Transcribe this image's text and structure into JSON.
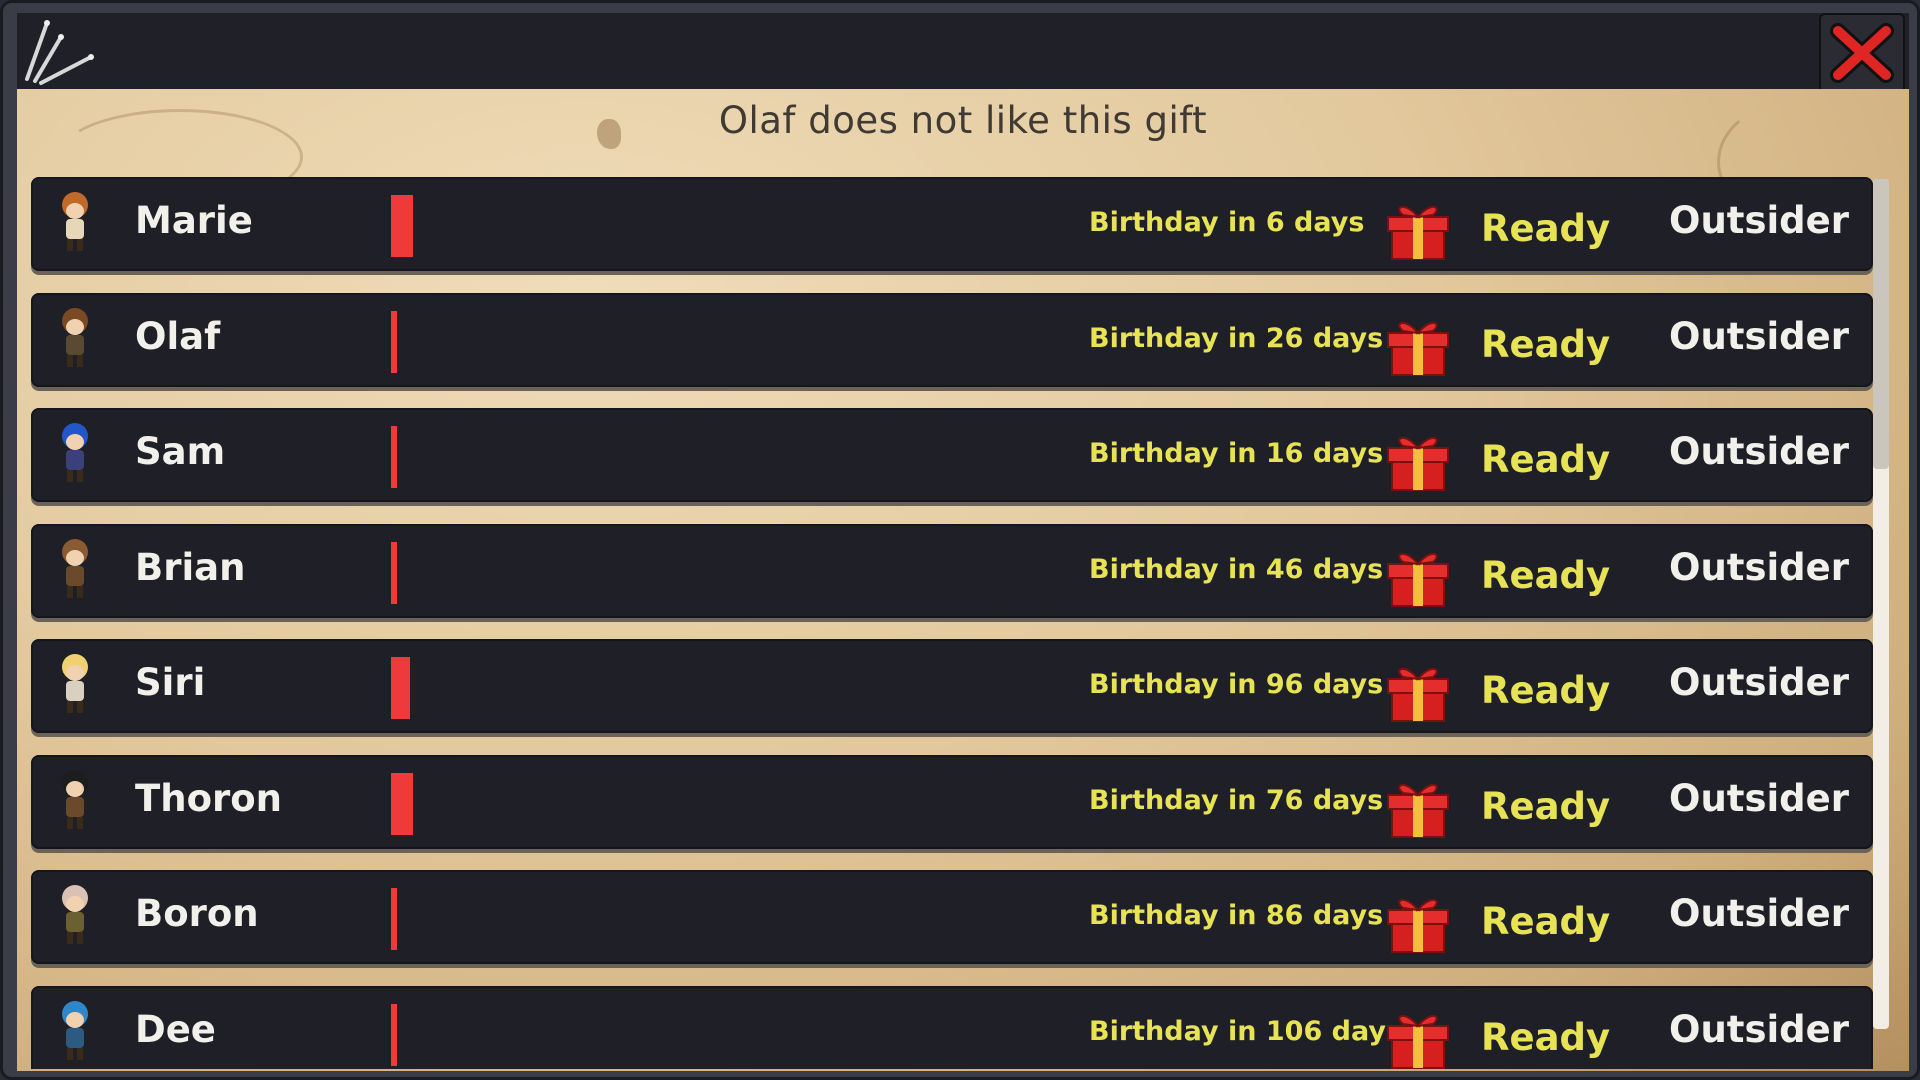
{
  "heading": "Olaf does not like this gift",
  "close_icon": "close-x-icon",
  "quill_icon": "quill-icon",
  "gift_icon": "gift-box-icon",
  "colors": {
    "bar": "#ee3a3a",
    "yellow_text": "#e8e355",
    "close": "#e02525"
  },
  "rows": [
    {
      "name": "Marie",
      "affection": 0.9,
      "birthday": "Birthday in 6 days",
      "gift_status": "Ready",
      "relation": "Outsider",
      "hair": "#c06a2a",
      "body": "#e6d7b8"
    },
    {
      "name": "Olaf",
      "affection": 0.2,
      "birthday": "Birthday in 26 days",
      "gift_status": "Ready",
      "relation": "Outsider",
      "hair": "#7a4a22",
      "body": "#5b4a32"
    },
    {
      "name": "Sam",
      "affection": 0.2,
      "birthday": "Birthday in 16 days",
      "gift_status": "Ready",
      "relation": "Outsider",
      "hair": "#2356c9",
      "body": "#3b3f7a"
    },
    {
      "name": "Brian",
      "affection": 0.2,
      "birthday": "Birthday in 46 days",
      "gift_status": "Ready",
      "relation": "Outsider",
      "hair": "#8a5a32",
      "body": "#6a4a2a"
    },
    {
      "name": "Siri",
      "affection": 0.8,
      "birthday": "Birthday in 96 days",
      "gift_status": "Ready",
      "relation": "Outsider",
      "hair": "#f0d070",
      "body": "#d9d0c0"
    },
    {
      "name": "Thoron",
      "affection": 0.9,
      "birthday": "Birthday in 76 days",
      "gift_status": "Ready",
      "relation": "Outsider",
      "hair": "#1d1d1d",
      "body": "#6b4a2c"
    },
    {
      "name": "Boron",
      "affection": 0.2,
      "birthday": "Birthday in 86 days",
      "gift_status": "Ready",
      "relation": "Outsider",
      "hair": "#d9c1b6",
      "body": "#6a6030"
    },
    {
      "name": "Dee",
      "affection": 0.2,
      "birthday": "Birthday in 106 days",
      "gift_status": "Ready",
      "relation": "Outsider",
      "hair": "#2f86c9",
      "body": "#2d5a80"
    }
  ]
}
